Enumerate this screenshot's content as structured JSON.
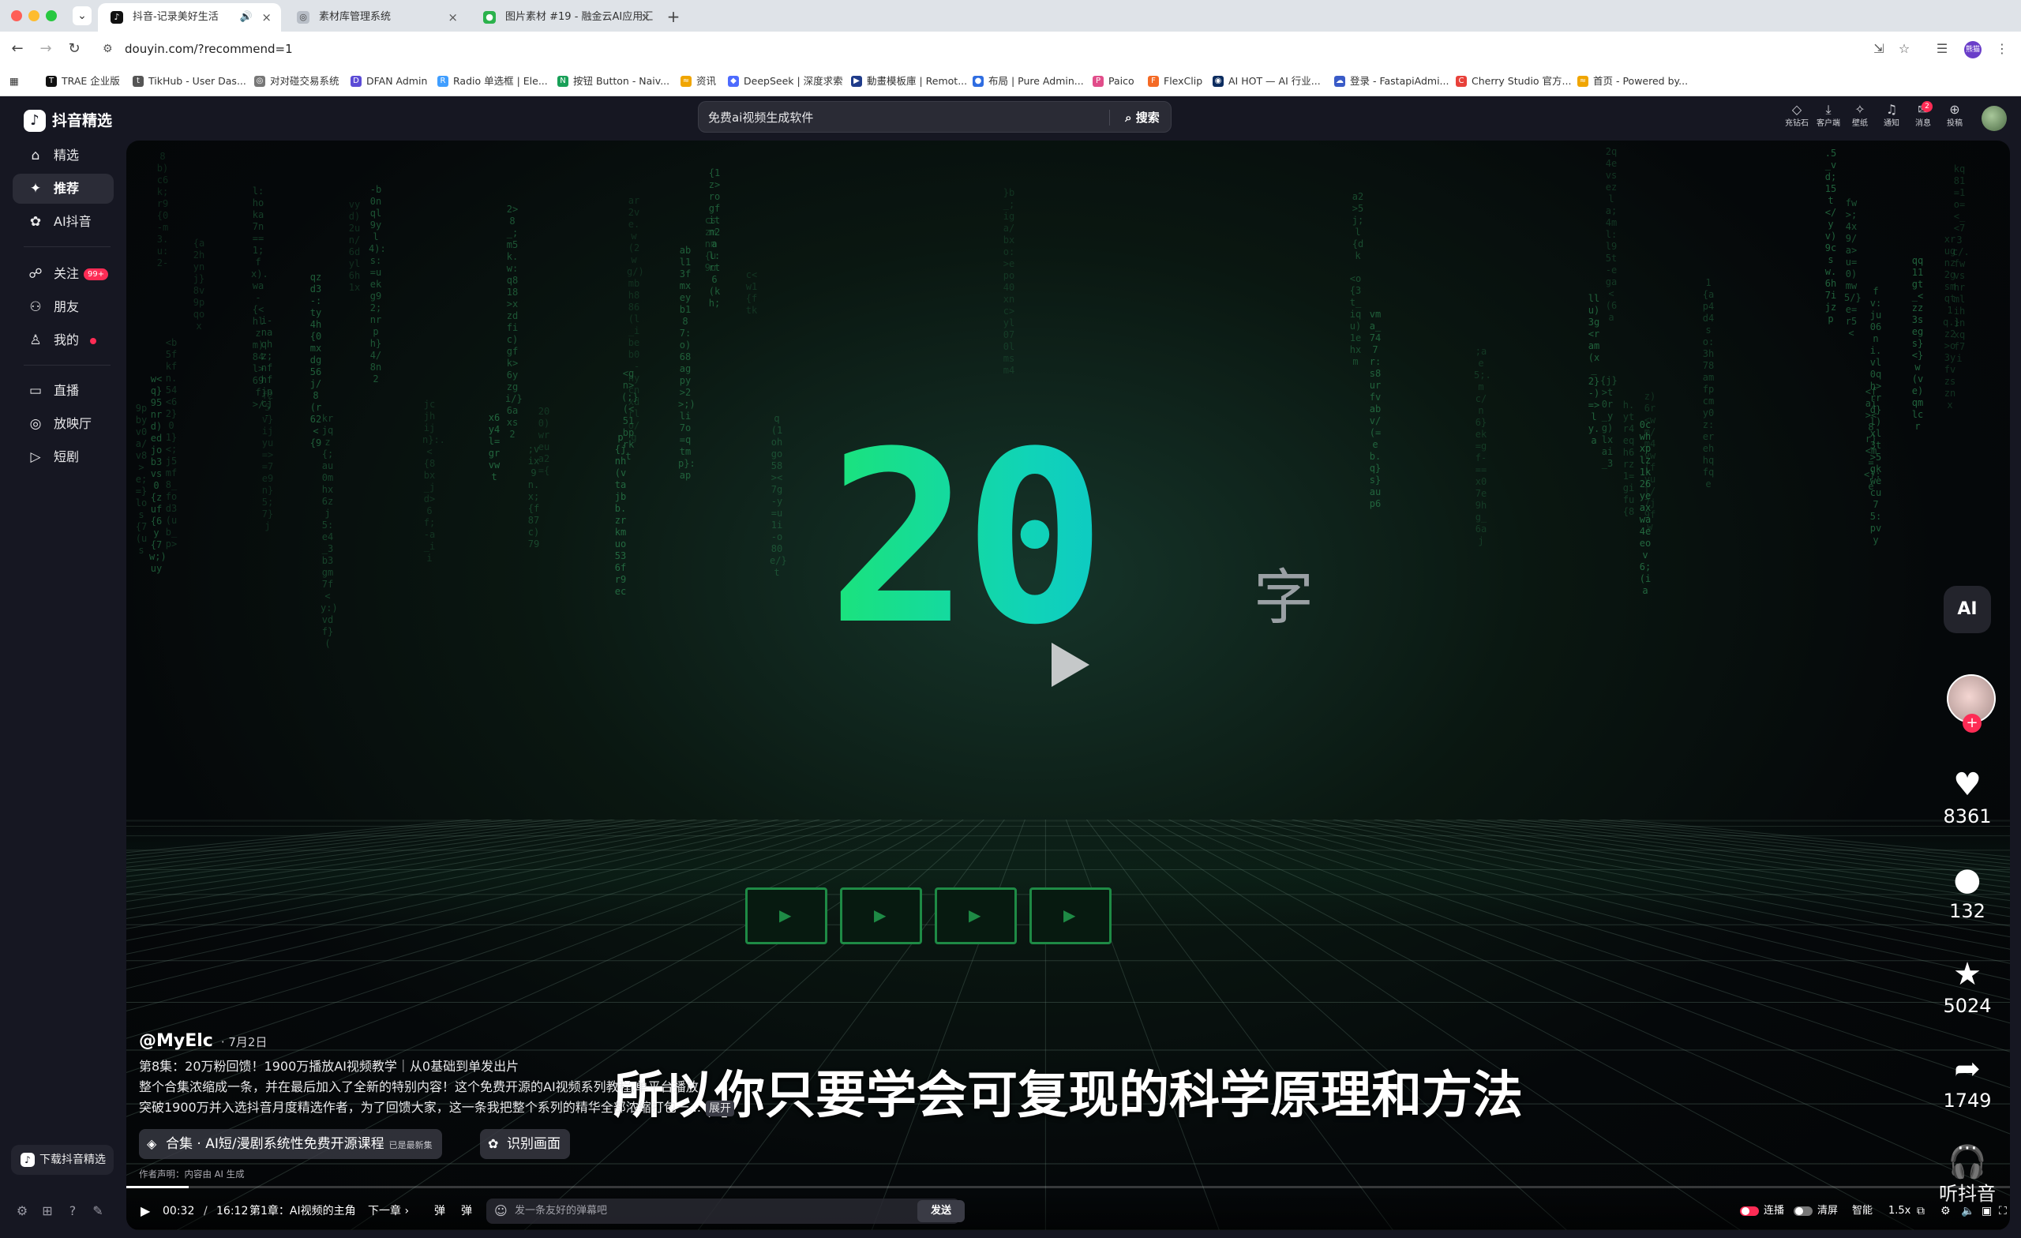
{
  "browser": {
    "tabs": [
      {
        "title": "抖音-记录美好生活",
        "active": true
      },
      {
        "title": "素材库管理系统",
        "active": false
      },
      {
        "title": "图片素材 #19 - 融金云AI应用汇",
        "active": false
      }
    ],
    "url": "douyin.com/?recommend=1",
    "bookmarks": [
      "TRAE 企业版",
      "TikHub - User Das...",
      "对对碰交易系统",
      "DFAN Admin",
      "Radio 单选框 | Ele...",
      "按钮 Button - Naiv...",
      "资讯",
      "DeepSeek | 深度求索",
      "動畫模板庫 | Remot...",
      "布局 | Pure Admin...",
      "Paico",
      "FlexClip",
      "AI HOT — AI 行业...",
      "登录 - FastapiAdmi...",
      "Cherry Studio 官方...",
      "首页 - Powered by..."
    ],
    "profile_label": "熊猫"
  },
  "sidebar": {
    "logo": "抖音精选",
    "items": [
      {
        "label": "精选",
        "icon": "home-icon"
      },
      {
        "label": "推荐",
        "icon": "sparkle-icon"
      },
      {
        "label": "AI抖音",
        "icon": "ai-flower-icon"
      },
      {
        "label": "关注",
        "icon": "follow-icon",
        "badge": "99+"
      },
      {
        "label": "朋友",
        "icon": "friends-icon"
      },
      {
        "label": "我的",
        "icon": "person-icon"
      },
      {
        "label": "直播",
        "icon": "tv-icon"
      },
      {
        "label": "放映厅",
        "icon": "cinema-icon"
      },
      {
        "label": "短剧",
        "icon": "short-drama-icon"
      }
    ],
    "download": "下载抖音精选"
  },
  "search": {
    "value": "免费ai视频生成软件",
    "button": "搜索"
  },
  "header_actions": [
    {
      "label": "充钻石",
      "icon": "diamond-icon"
    },
    {
      "label": "客户端",
      "icon": "download-icon"
    },
    {
      "label": "壁纸",
      "icon": "wallpaper-icon"
    },
    {
      "label": "通知",
      "icon": "bell-icon"
    },
    {
      "label": "消息",
      "icon": "message-icon",
      "badge": "2"
    },
    {
      "label": "投稿",
      "icon": "upload-icon"
    }
  ],
  "video": {
    "big_number": "20",
    "big_suffix": "字",
    "subtitle": "所以你只要学会可复现的科学原理和方法",
    "author": "@MyElc",
    "date": "· 7月2日",
    "desc_lines": [
      "第8集：20万粉回馈！1900万播放AI视频教学｜从0基础到单发出片",
      "整个合集浓缩成一条，并在最后加入了全新的特别内容！这个免费开源的AI视频系列教程,单平台播放",
      "突破1900万并入选抖音月度精选作者，为了回馈大家，这一条我把整个系列的精华全部浓缩打包一..."
    ],
    "expand": "展开",
    "collection": "合集 · AI短/漫剧系统性免费开源课程",
    "collection_status": "已是最新集",
    "recognize": "识别画面",
    "declaration": "作者声明：内容由 AI 生成",
    "ai_badge": "AI",
    "stats": {
      "likes": "8361",
      "comments": "132",
      "favorites": "5024",
      "shares": "1749",
      "listen": "听抖音"
    },
    "progress": 0.033
  },
  "controls": {
    "current_time": "00:32",
    "sep": "/",
    "duration": "16:12",
    "chapter": "第1章：AI视频的主角",
    "next": "下一章",
    "danmu_placeholder": "发一条友好的弹幕吧",
    "send": "发送",
    "autoplay": "连播",
    "clear": "清屏",
    "smart": "智能",
    "speed": "1.5x"
  },
  "colors": {
    "accent": "#fe2c55",
    "bg": "#161722",
    "neon_start": "#1be37a",
    "neon_end": "#0ab8d8"
  }
}
